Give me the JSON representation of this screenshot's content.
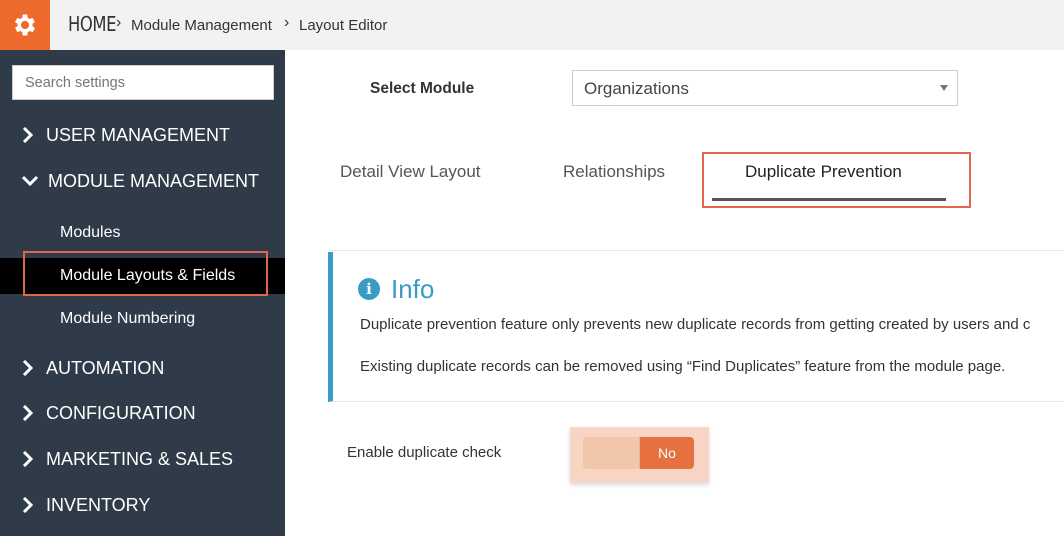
{
  "header": {
    "home": "HOME",
    "breadcrumbs": [
      "Module Management",
      "Layout Editor"
    ],
    "brand_color": "#ee6a2c"
  },
  "sidebar": {
    "search_placeholder": "Search settings",
    "sections": [
      {
        "label": "USER MANAGEMENT",
        "icon": "chevron-right-icon"
      },
      {
        "label": "MODULE MANAGEMENT",
        "icon": "chevron-down-icon"
      },
      {
        "label": "AUTOMATION",
        "icon": "chevron-right-icon"
      },
      {
        "label": "CONFIGURATION",
        "icon": "chevron-right-icon"
      },
      {
        "label": "MARKETING & SALES",
        "icon": "chevron-right-icon"
      },
      {
        "label": "INVENTORY",
        "icon": "chevron-right-icon"
      }
    ],
    "module_items": [
      "Modules",
      "Module Layouts & Fields",
      "Module Numbering"
    ],
    "active_item": "Module Layouts & Fields"
  },
  "main": {
    "select_label": "Select Module",
    "select_value": "Organizations",
    "tabs": [
      "Detail View Layout",
      "Relationships",
      "Duplicate Prevention"
    ],
    "active_tab": "Duplicate Prevention",
    "info": {
      "title": "Info",
      "line1": "Duplicate prevention feature only prevents new duplicate records from getting created by users and c",
      "line2": "Existing duplicate records can be removed using “Find Duplicates” feature from the module page."
    },
    "dup_check_label": "Enable duplicate check",
    "dup_check_value": "No",
    "accent_color": "#3a9bc7",
    "highlight_color": "#e2664b"
  }
}
